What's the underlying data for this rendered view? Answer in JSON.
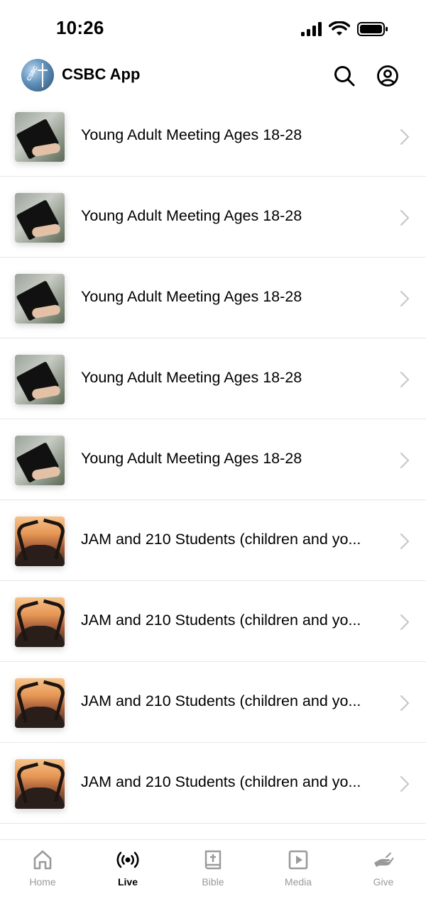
{
  "status_bar": {
    "time": "10:26"
  },
  "header": {
    "title": "CSBC App",
    "logo_text": "CSBC"
  },
  "items": [
    {
      "title": "Young Adult Meeting Ages 18-28",
      "thumbnail": "bible-hands-photo"
    },
    {
      "title": "Young Adult Meeting Ages 18-28",
      "thumbnail": "bible-hands-photo"
    },
    {
      "title": "Young Adult Meeting Ages 18-28",
      "thumbnail": "bible-hands-photo"
    },
    {
      "title": "Young Adult Meeting Ages 18-28",
      "thumbnail": "bible-hands-photo"
    },
    {
      "title": "Young Adult Meeting Ages 18-28",
      "thumbnail": "bible-hands-photo"
    },
    {
      "title": "JAM and 210 Students (children and yo...",
      "thumbnail": "sunset-hearts-photo"
    },
    {
      "title": "JAM and 210 Students (children and yo...",
      "thumbnail": "sunset-hearts-photo"
    },
    {
      "title": "JAM and 210 Students (children and yo...",
      "thumbnail": "sunset-hearts-photo"
    },
    {
      "title": "JAM and 210 Students (children and yo...",
      "thumbnail": "sunset-hearts-photo"
    }
  ],
  "tabs": [
    {
      "label": "Home",
      "icon": "home-icon",
      "active": false
    },
    {
      "label": "Live",
      "icon": "broadcast-icon",
      "active": true
    },
    {
      "label": "Bible",
      "icon": "bible-icon",
      "active": false
    },
    {
      "label": "Media",
      "icon": "play-icon",
      "active": false
    },
    {
      "label": "Give",
      "icon": "give-hand-icon",
      "active": false
    }
  ],
  "colors": {
    "active": "#000000",
    "inactive": "#9a9a9a",
    "divider": "#e6e6e6",
    "chevron": "#c7c7cc"
  }
}
